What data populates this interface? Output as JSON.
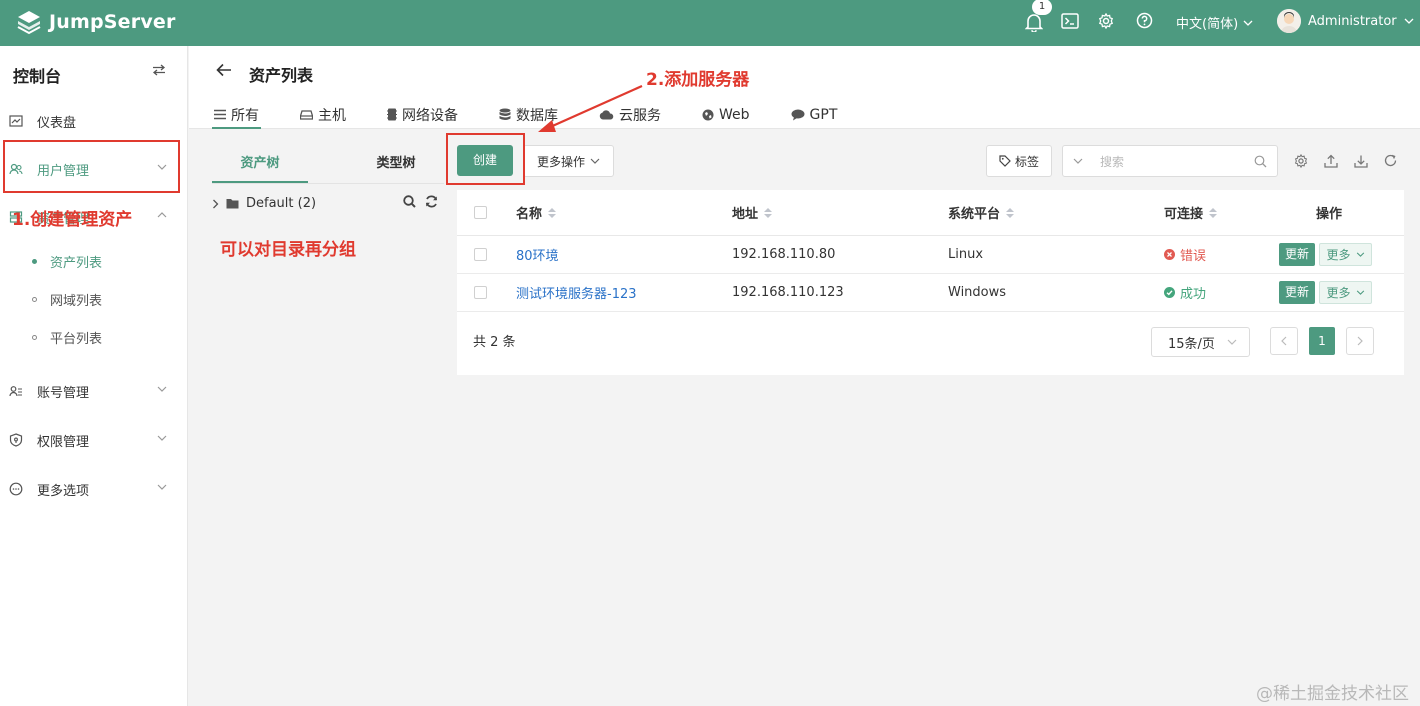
{
  "header": {
    "app_name": "JumpServer",
    "notification_count": "1",
    "language": "中文(简体)",
    "user_name": "Administrator"
  },
  "sidebar": {
    "title": "控制台",
    "items": [
      {
        "label": "仪表盘"
      },
      {
        "label": "用户管理"
      },
      {
        "label": "资产管理"
      },
      {
        "label": "账号管理"
      },
      {
        "label": "权限管理"
      },
      {
        "label": "更多选项"
      }
    ],
    "sub_items": [
      {
        "label": "资产列表"
      },
      {
        "label": "网域列表"
      },
      {
        "label": "平台列表"
      }
    ]
  },
  "page": {
    "title": "资产列表",
    "tabs": [
      {
        "label": "所有"
      },
      {
        "label": "主机"
      },
      {
        "label": "网络设备"
      },
      {
        "label": "数据库"
      },
      {
        "label": "云服务"
      },
      {
        "label": "Web"
      },
      {
        "label": "GPT"
      }
    ]
  },
  "tree": {
    "tab_asset": "资产树",
    "tab_type": "类型树",
    "node_label": "Default (2)"
  },
  "toolbar": {
    "create_label": "创建",
    "more_label": "更多操作",
    "tag_label": "标签",
    "search_placeholder": "搜索"
  },
  "table": {
    "columns": [
      "名称",
      "地址",
      "系统平台",
      "可连接",
      "操作"
    ],
    "rows": [
      {
        "name": "80环境",
        "address": "192.168.110.80",
        "platform": "Linux",
        "status": "错误",
        "update": "更新",
        "more": "更多"
      },
      {
        "name": "测试环境服务器-123",
        "address": "192.168.110.123",
        "platform": "Windows",
        "status": "成功",
        "update": "更新",
        "more": "更多"
      }
    ],
    "total": "共 2 条",
    "page_size": "15条/页",
    "current_page": "1"
  },
  "annotations": {
    "step1": "1.创建管理资产",
    "step2": "2.添加服务器",
    "note": "可以对目录再分组"
  },
  "watermark": "@稀土掘金技术社区",
  "colors": {
    "primary": "#4d9a80",
    "annotation": "#e03a2f",
    "link": "#2a72c8",
    "error": "#e15a52",
    "success": "#44a57c"
  }
}
